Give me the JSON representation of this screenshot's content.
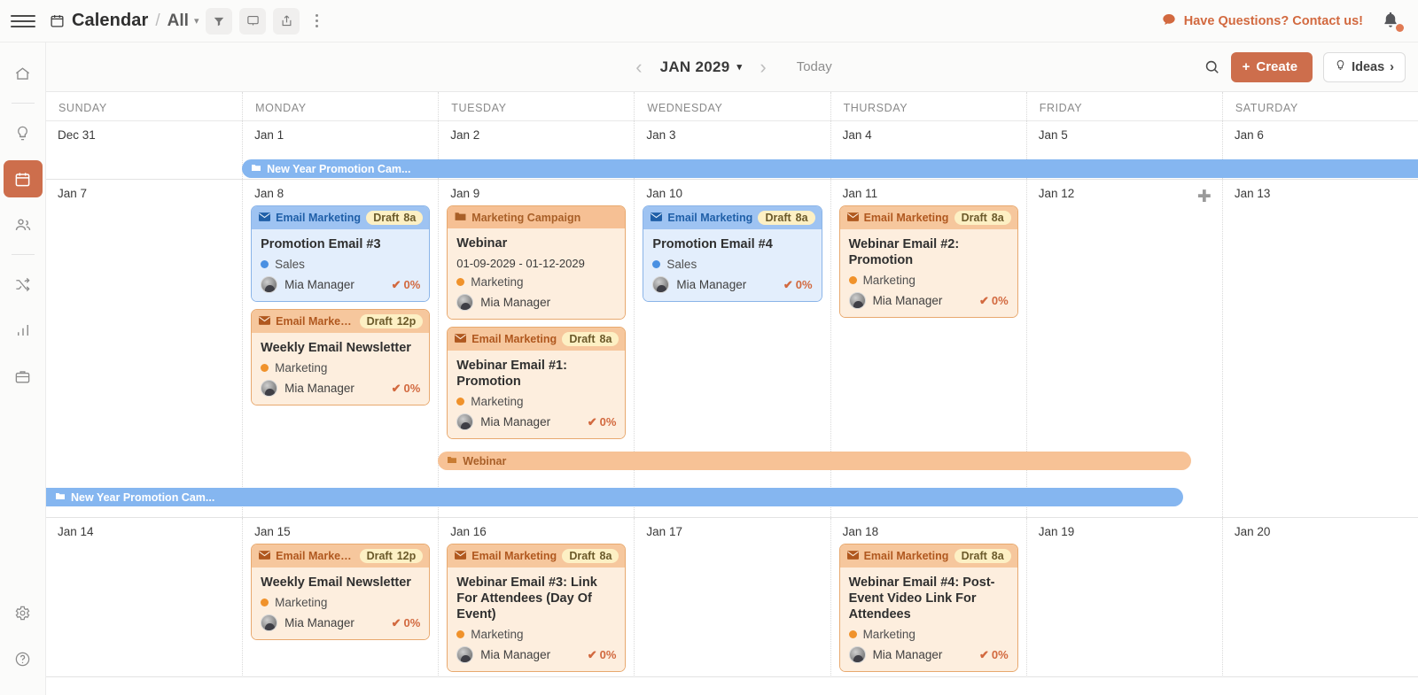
{
  "topbar": {
    "menu_icon": "hamburger-icon",
    "breadcrumb_icon": "calendar-icon",
    "title": "Calendar",
    "separator": "/",
    "scope": "All",
    "scope_chevron": "chevron-down-icon",
    "actions": [
      {
        "icon": "filter-icon",
        "name": "filter-button"
      },
      {
        "icon": "display-icon",
        "name": "display-button"
      },
      {
        "icon": "share-icon",
        "name": "share-button"
      }
    ],
    "more_icon": "kebab-menu-icon",
    "contact": {
      "icon": "speech-bubble-icon",
      "label": "Have Questions? Contact us!"
    },
    "bell_icon": "notification-bell-icon"
  },
  "sidebar": {
    "items": [
      {
        "icon": "home-icon",
        "name": "sidebar-item-home",
        "active": false
      },
      {
        "icon": "lightbulb-icon",
        "name": "sidebar-item-ideas",
        "active": false
      },
      {
        "icon": "calendar-icon",
        "name": "sidebar-item-calendar",
        "active": true
      },
      {
        "icon": "people-icon",
        "name": "sidebar-item-people",
        "active": false
      },
      {
        "icon": "shuffle-icon",
        "name": "sidebar-item-workflows",
        "active": false
      },
      {
        "icon": "bar-chart-icon",
        "name": "sidebar-item-analytics",
        "active": false
      },
      {
        "icon": "briefcase-icon",
        "name": "sidebar-item-projects",
        "active": false
      }
    ],
    "bottom": [
      {
        "icon": "gear-icon",
        "name": "sidebar-item-settings"
      },
      {
        "icon": "help-icon",
        "name": "sidebar-item-help"
      }
    ]
  },
  "toolbar": {
    "prev_icon": "chevron-left-icon",
    "next_icon": "chevron-right-icon",
    "month": "JAN 2029",
    "month_chevron": "chevron-down-icon",
    "today_label": "Today",
    "search_icon": "search-icon",
    "create_label": "Create",
    "create_plus": "+",
    "create_color": "#cd6e4c",
    "ideas_label": "Ideas",
    "ideas_icon": "lightbulb-icon",
    "ideas_arrow": "›"
  },
  "calendar": {
    "day_headers": [
      "SUNDAY",
      "MONDAY",
      "TUESDAY",
      "WEDNESDAY",
      "THURSDAY",
      "FRIDAY",
      "SATURDAY"
    ],
    "weeks": [
      {
        "days": [
          "Dec 31",
          "Jan 1",
          "Jan 2",
          "Jan 3",
          "Jan 4",
          "Jan 5",
          "Jan 6"
        ],
        "bar": {
          "label": "New Year Promotion Cam...",
          "icon": "folder-icon",
          "color": "#85b6f0",
          "start": 1,
          "span": 6
        }
      },
      {
        "days": [
          "Jan 7",
          "Jan 8",
          "Jan 9",
          "Jan 10",
          "Jan 11",
          "Jan 12",
          "Jan 13"
        ],
        "plus_day_index": 5,
        "bottom_bars": [
          {
            "label": "Webinar",
            "icon": "folder-icon",
            "style": "orange",
            "start": 2,
            "span": 4
          },
          {
            "label": "New Year Promotion Cam...",
            "icon": "folder-icon",
            "style": "blue",
            "start": 0,
            "span": 6
          }
        ]
      },
      {
        "days": [
          "Jan 14",
          "Jan 15",
          "Jan 16",
          "Jan 17",
          "Jan 18",
          "Jan 19",
          "Jan 20"
        ]
      }
    ],
    "events": {
      "jan8": [
        {
          "type": "email",
          "style": "blue",
          "head_icon": "envelope-icon",
          "head_label": "Email Marketing",
          "badge_status": "Draft",
          "badge_time": "8a",
          "title": "Promotion Email #3",
          "tag": "Sales",
          "tag_color": "#4a90e2",
          "assignee": "Mia Manager",
          "progress": "0%",
          "check_icon": "check-icon"
        },
        {
          "type": "email",
          "style": "orange",
          "head_icon": "envelope-icon",
          "head_label": "Email Marketi...",
          "badge_status": "Draft",
          "badge_time": "12p",
          "title": "Weekly Email Newsletter",
          "tag": "Marketing",
          "tag_color": "#f0922b",
          "assignee": "Mia Manager",
          "progress": "0%",
          "check_icon": "check-icon"
        }
      ],
      "jan9": [
        {
          "type": "folder",
          "style": "folder",
          "head_icon": "folder-icon",
          "head_label": "Marketing Campaign",
          "title": "Webinar",
          "date_range": "01-09-2029 - 01-12-2029",
          "tag": "Marketing",
          "tag_color": "#f0922b",
          "assignee": "Mia Manager"
        },
        {
          "type": "email",
          "style": "orange",
          "head_icon": "envelope-icon",
          "head_label": "Email Marketing",
          "badge_status": "Draft",
          "badge_time": "8a",
          "title": "Webinar Email #1: Promotion",
          "tag": "Marketing",
          "tag_color": "#f0922b",
          "assignee": "Mia Manager",
          "progress": "0%",
          "check_icon": "check-icon"
        }
      ],
      "jan10": [
        {
          "type": "email",
          "style": "blue",
          "head_icon": "envelope-icon",
          "head_label": "Email Marketing",
          "badge_status": "Draft",
          "badge_time": "8a",
          "title": "Promotion Email #4",
          "tag": "Sales",
          "tag_color": "#4a90e2",
          "assignee": "Mia Manager",
          "progress": "0%",
          "check_icon": "check-icon"
        }
      ],
      "jan11": [
        {
          "type": "email",
          "style": "orange",
          "head_icon": "envelope-icon",
          "head_label": "Email Marketing",
          "badge_status": "Draft",
          "badge_time": "8a",
          "title": "Webinar Email #2: Promotion",
          "tag": "Marketing",
          "tag_color": "#f0922b",
          "assignee": "Mia Manager",
          "progress": "0%",
          "check_icon": "check-icon"
        }
      ],
      "jan15": [
        {
          "type": "email",
          "style": "orange",
          "head_icon": "envelope-icon",
          "head_label": "Email Marketi...",
          "badge_status": "Draft",
          "badge_time": "12p",
          "title": "Weekly Email Newsletter",
          "tag": "Marketing",
          "tag_color": "#f0922b",
          "assignee": "Mia Manager",
          "progress": "0%",
          "check_icon": "check-icon"
        }
      ],
      "jan16": [
        {
          "type": "email",
          "style": "orange",
          "head_icon": "envelope-icon",
          "head_label": "Email Marketing",
          "badge_status": "Draft",
          "badge_time": "8a",
          "title": "Webinar Email #3: Link For Attendees (Day Of Event)",
          "tag": "Marketing",
          "tag_color": "#f0922b",
          "assignee": "Mia Manager",
          "progress": "0%",
          "check_icon": "check-icon"
        }
      ],
      "jan18": [
        {
          "type": "email",
          "style": "orange",
          "head_icon": "envelope-icon",
          "head_label": "Email Marketing",
          "badge_status": "Draft",
          "badge_time": "8a",
          "title": "Webinar Email #4: Post-Event Video Link For Attendees",
          "tag": "Marketing",
          "tag_color": "#f0922b",
          "assignee": "Mia Manager",
          "progress": "0%",
          "check_icon": "check-icon"
        }
      ]
    }
  }
}
